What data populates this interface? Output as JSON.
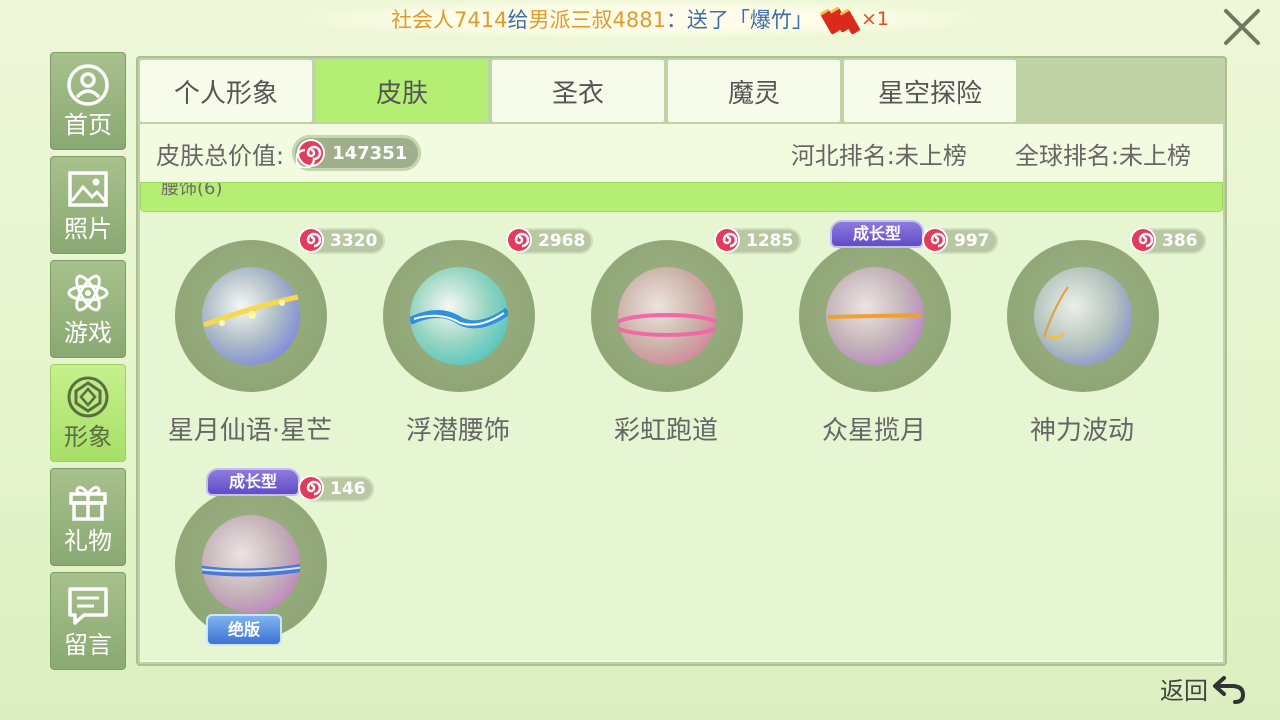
{
  "banner": {
    "sender": "社会人7414",
    "gave_text": "给",
    "receiver": "男派三叔4881",
    "sent_text": "：送了「爆竹」",
    "count": "×1",
    "item_icon": "firecracker-icon"
  },
  "sidebar": {
    "items": [
      {
        "label": "首页",
        "icon": "person-icon"
      },
      {
        "label": "照片",
        "icon": "photo-icon"
      },
      {
        "label": "游戏",
        "icon": "atom-icon"
      },
      {
        "label": "形象",
        "icon": "gem-icon",
        "active": true
      },
      {
        "label": "礼物",
        "icon": "gift-icon"
      },
      {
        "label": "留言",
        "icon": "message-icon"
      }
    ]
  },
  "tabs": [
    {
      "label": "个人形象"
    },
    {
      "label": "皮肤",
      "active": true
    },
    {
      "label": "圣衣"
    },
    {
      "label": "魔灵"
    },
    {
      "label": "星空探险"
    }
  ],
  "stats": {
    "total_label": "皮肤总价值:",
    "total_value": "147351",
    "rank_province": "河北排名:未上榜",
    "rank_global": "全球排名:未上榜"
  },
  "section": {
    "label": "腰饰(6)"
  },
  "items": [
    {
      "name": "星月仙语·星芒",
      "price": "3320"
    },
    {
      "name": "浮潜腰饰",
      "price": "2968"
    },
    {
      "name": "彩虹跑道",
      "price": "1285"
    },
    {
      "name": "众星揽月",
      "price": "997",
      "badge": "成长型"
    },
    {
      "name": "神力波动",
      "price": "386"
    },
    {
      "name": "",
      "price": "146",
      "badge": "成长型",
      "bottom_badge": "绝版"
    }
  ],
  "back_label": "返回",
  "colors": {
    "accent_green": "#b4ef74",
    "background": "#eef7d8",
    "sidebar_green": "#8aa972",
    "candy_red": "#e33b5a"
  }
}
